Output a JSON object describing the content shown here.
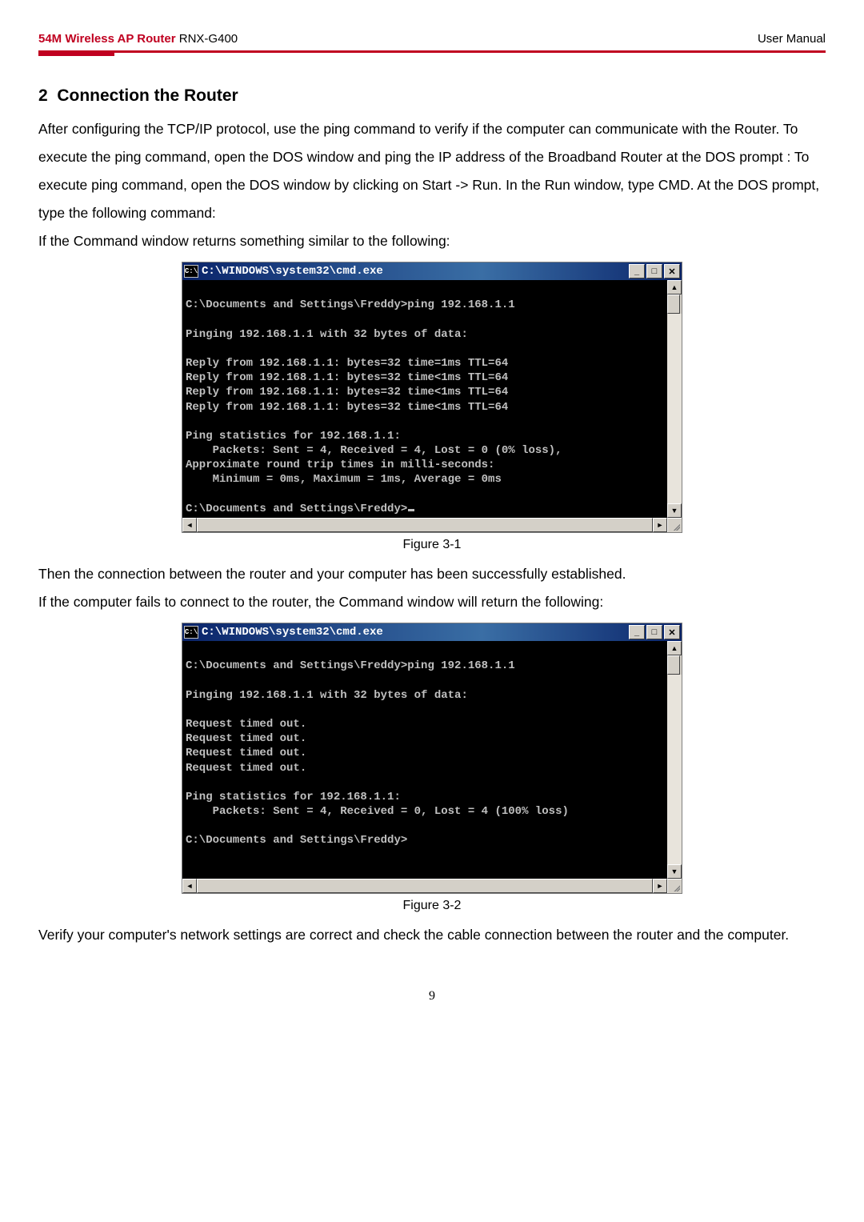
{
  "header": {
    "product": "54M Wireless AP Router",
    "model": "RNX-G400",
    "doc_type": "User Manual"
  },
  "section": {
    "number": "2",
    "title": "Connection the Router"
  },
  "para1": "After configuring the TCP/IP protocol, use the ping command to verify if the computer can communicate with the Router. To execute the ping command, open the DOS window and ping the IP address of the Broadband Router at the DOS prompt : To execute ping command, open the DOS window by clicking on Start -> Run. In the Run window, type CMD. At the DOS prompt, type the following command:",
  "para2": "If the Command window returns something similar to the following:",
  "cmd1": {
    "title": "C:\\WINDOWS\\system32\\cmd.exe",
    "lines": [
      "",
      "C:\\Documents and Settings\\Freddy>ping 192.168.1.1",
      "",
      "Pinging 192.168.1.1 with 32 bytes of data:",
      "",
      "Reply from 192.168.1.1: bytes=32 time=1ms TTL=64",
      "Reply from 192.168.1.1: bytes=32 time<1ms TTL=64",
      "Reply from 192.168.1.1: bytes=32 time<1ms TTL=64",
      "Reply from 192.168.1.1: bytes=32 time<1ms TTL=64",
      "",
      "Ping statistics for 192.168.1.1:",
      "    Packets: Sent = 4, Received = 4, Lost = 0 (0% loss),",
      "Approximate round trip times in milli-seconds:",
      "    Minimum = 0ms, Maximum = 1ms, Average = 0ms",
      "",
      "C:\\Documents and Settings\\Freddy>"
    ]
  },
  "fig1_caption": "Figure 3-1",
  "para3": "Then the connection between the router and your computer has been successfully established.",
  "para4": "If the computer fails to connect to the router, the Command window will return the following:",
  "cmd2": {
    "title": "C:\\WINDOWS\\system32\\cmd.exe",
    "lines": [
      "",
      "C:\\Documents and Settings\\Freddy>ping 192.168.1.1",
      "",
      "Pinging 192.168.1.1 with 32 bytes of data:",
      "",
      "Request timed out.",
      "Request timed out.",
      "Request timed out.",
      "Request timed out.",
      "",
      "Ping statistics for 192.168.1.1:",
      "    Packets: Sent = 4, Received = 0, Lost = 4 (100% loss)",
      "",
      "C:\\Documents and Settings\\Freddy>",
      "",
      ""
    ]
  },
  "fig2_caption": "Figure 3-2",
  "para5": "Verify your computer's network settings are correct and check the cable connection between the router and the computer.",
  "page_number": "9",
  "winbuttons": {
    "min": "_",
    "max": "□",
    "close": "✕"
  },
  "icon_label": "C:\\"
}
